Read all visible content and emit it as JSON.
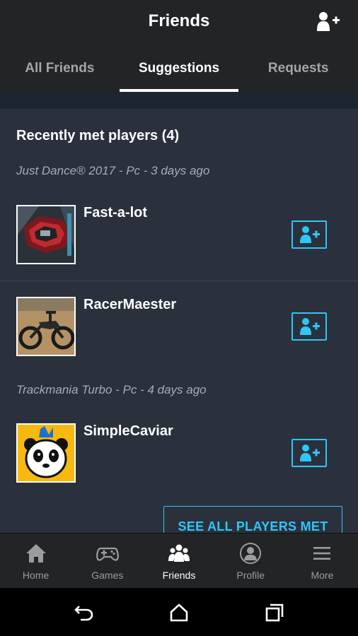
{
  "header": {
    "title": "Friends",
    "add_friend_icon": "add-person-icon"
  },
  "tabs": [
    {
      "label": "All Friends",
      "active": false
    },
    {
      "label": "Suggestions",
      "active": true
    },
    {
      "label": "Requests",
      "active": false
    }
  ],
  "section": {
    "title": "Recently met players (4)"
  },
  "groups": [
    {
      "game": "Just Dance® 2017 - Pc - 3 days ago",
      "players": [
        {
          "name": "Fast-a-lot",
          "avatar_icon": "car-avatar"
        },
        {
          "name": "RacerMaester",
          "avatar_icon": "motorbike-avatar"
        }
      ]
    },
    {
      "game": "Trackmania Turbo - Pc - 4 days ago",
      "players": [
        {
          "name": "SimpleCaviar",
          "avatar_icon": "panda-avatar"
        }
      ]
    }
  ],
  "see_all_label": "SEE ALL PLAYERS MET",
  "nav": [
    {
      "label": "Home",
      "icon": "home-icon",
      "active": false
    },
    {
      "label": "Games",
      "icon": "gamepad-icon",
      "active": false
    },
    {
      "label": "Friends",
      "icon": "friends-icon",
      "active": true
    },
    {
      "label": "Profile",
      "icon": "profile-icon",
      "active": false
    },
    {
      "label": "More",
      "icon": "menu-icon",
      "active": false
    }
  ],
  "system_nav": [
    "back-icon",
    "home-icon",
    "recents-icon"
  ],
  "colors": {
    "accent": "#2fc6f6",
    "header_bg": "#222426",
    "content_bg": "#2a313d",
    "muted_text": "#a6acb6"
  }
}
